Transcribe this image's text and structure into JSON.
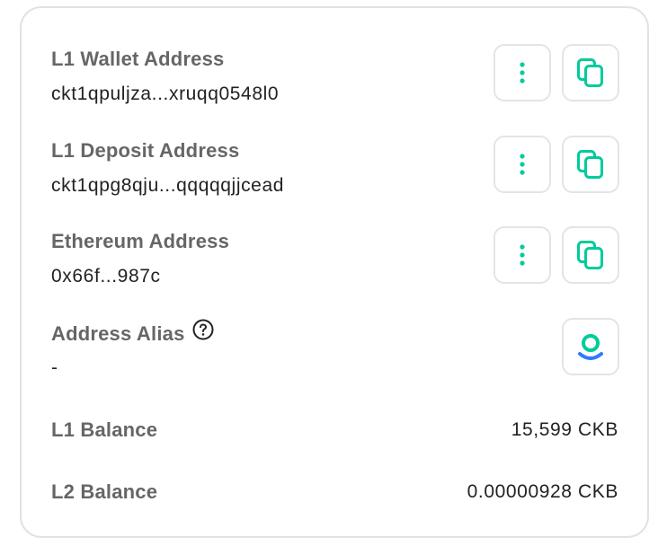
{
  "colors": {
    "accent_green": "#00cc9b",
    "accent_blue": "#2e7bff",
    "label_gray": "#666666",
    "value_dark": "#222222",
    "border": "#e2e2e2"
  },
  "addresses": [
    {
      "label": "L1 Wallet Address",
      "value": "ckt1qpuljza...xruqq0548l0",
      "more_icon": "vertical-dots-icon",
      "copy_icon": "copy-icon"
    },
    {
      "label": "L1 Deposit Address",
      "value": "ckt1qpg8qju...qqqqqjjcead",
      "more_icon": "vertical-dots-icon",
      "copy_icon": "copy-icon"
    },
    {
      "label": "Ethereum Address",
      "value": "0x66f...987c",
      "more_icon": "vertical-dots-icon",
      "copy_icon": "copy-icon"
    }
  ],
  "alias": {
    "label": "Address Alias",
    "value": "-",
    "help_icon": "question-circle-icon",
    "action_icon": "alias-logo-icon"
  },
  "balances": [
    {
      "label": "L1 Balance",
      "value": "15,599 CKB"
    },
    {
      "label": "L2 Balance",
      "value": "0.00000928 CKB"
    }
  ]
}
